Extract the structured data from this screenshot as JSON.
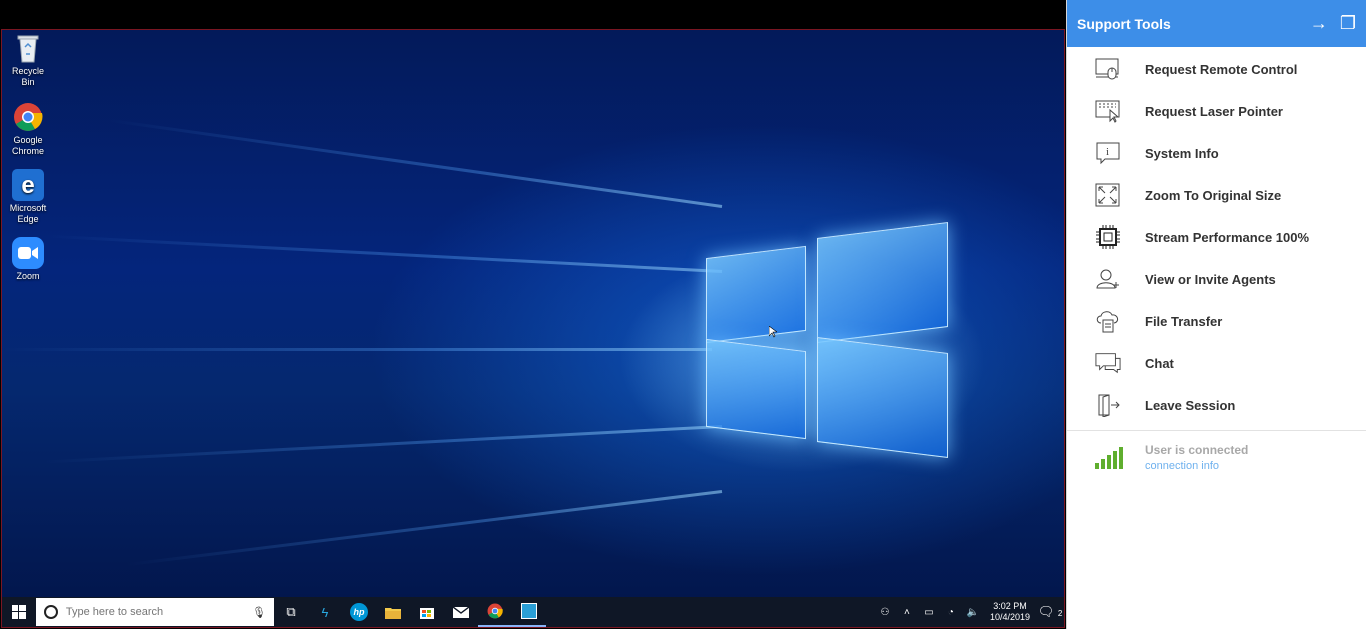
{
  "desktop": {
    "icons": [
      {
        "label": "Recycle Bin",
        "icon": "recycle-bin-icon"
      },
      {
        "label": "Google Chrome",
        "icon": "chrome-icon"
      },
      {
        "label": "Microsoft Edge",
        "icon": "edge-icon"
      },
      {
        "label": "Zoom",
        "icon": "zoom-icon"
      }
    ]
  },
  "taskbar": {
    "search_placeholder": "Type here to search",
    "time": "3:02 PM",
    "date": "10/4/2019",
    "notification_count": "2"
  },
  "panel": {
    "title": "Support Tools",
    "items": [
      {
        "label": "Request Remote Control",
        "icon": "remote-control-icon"
      },
      {
        "label": "Request Laser Pointer",
        "icon": "laser-pointer-icon"
      },
      {
        "label": "System Info",
        "icon": "system-info-icon"
      },
      {
        "label": "Zoom To Original Size",
        "icon": "zoom-original-size-icon"
      },
      {
        "label": "Stream Performance 100%",
        "icon": "cpu-chip-icon"
      },
      {
        "label": "View or Invite Agents",
        "icon": "agents-icon"
      },
      {
        "label": "File Transfer",
        "icon": "file-transfer-icon"
      },
      {
        "label": "Chat",
        "icon": "chat-icon"
      },
      {
        "label": "Leave Session",
        "icon": "leave-session-icon"
      }
    ],
    "status": {
      "text": "User is connected",
      "link": "connection info"
    }
  },
  "colors": {
    "panel_header": "#3d8ee8",
    "signal_green": "#5fae2e",
    "link_blue": "#6fb1ee"
  }
}
